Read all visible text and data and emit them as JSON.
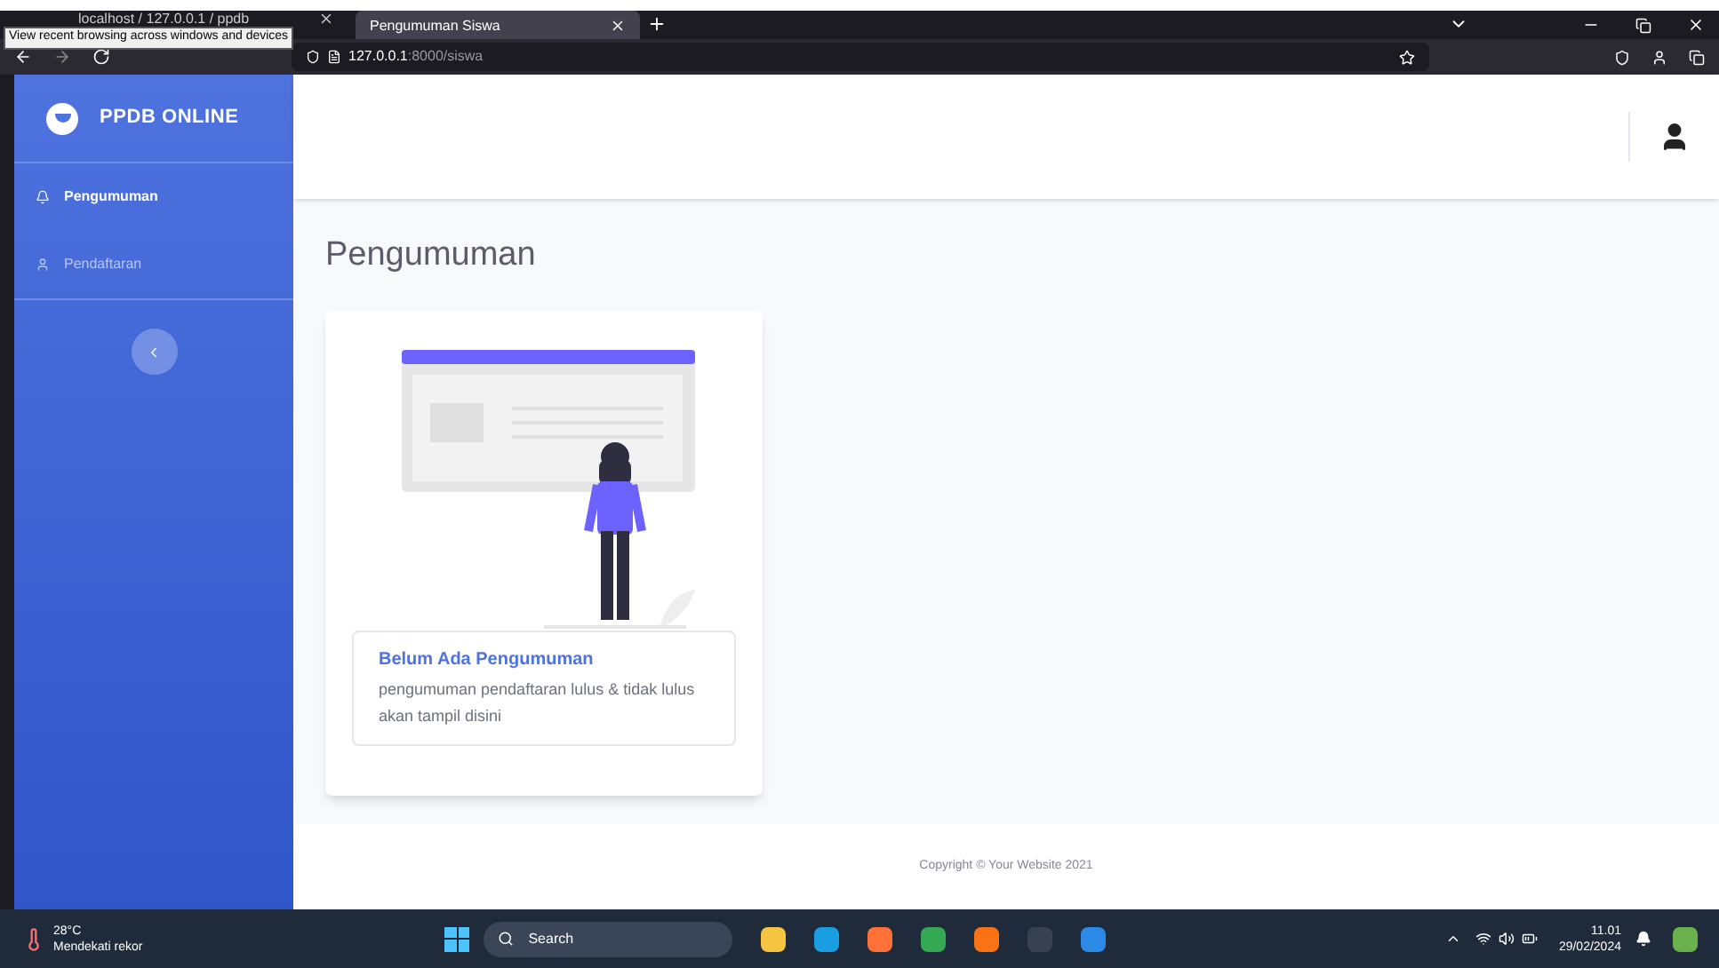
{
  "browser": {
    "tabs": [
      {
        "label": "localhost / 127.0.0.1 / ppdb",
        "selected": false
      },
      {
        "label": "Pengumuman Siswa",
        "selected": true
      }
    ],
    "tooltip": "View recent browsing across windows and devices",
    "url_host": "127.0.0.1",
    "url_path": ":8000/siswa"
  },
  "sidebar": {
    "brand": "PPDB ONLINE",
    "items": [
      {
        "label": "Pengumuman",
        "selected": true
      },
      {
        "label": "Pendaftaran",
        "selected": false
      }
    ]
  },
  "page": {
    "title": "Pengumuman",
    "card": {
      "heading": "Belum Ada Pengumuman",
      "text": "pengumuman pendaftaran lulus & tidak lulus akan tampil disini"
    }
  },
  "footer": "Copyright © Your Website 2021",
  "taskbar": {
    "temperature": "28°C",
    "weather": "Mendekati rekor",
    "search": "Search",
    "time": "11.01",
    "date": "29/02/2024"
  }
}
